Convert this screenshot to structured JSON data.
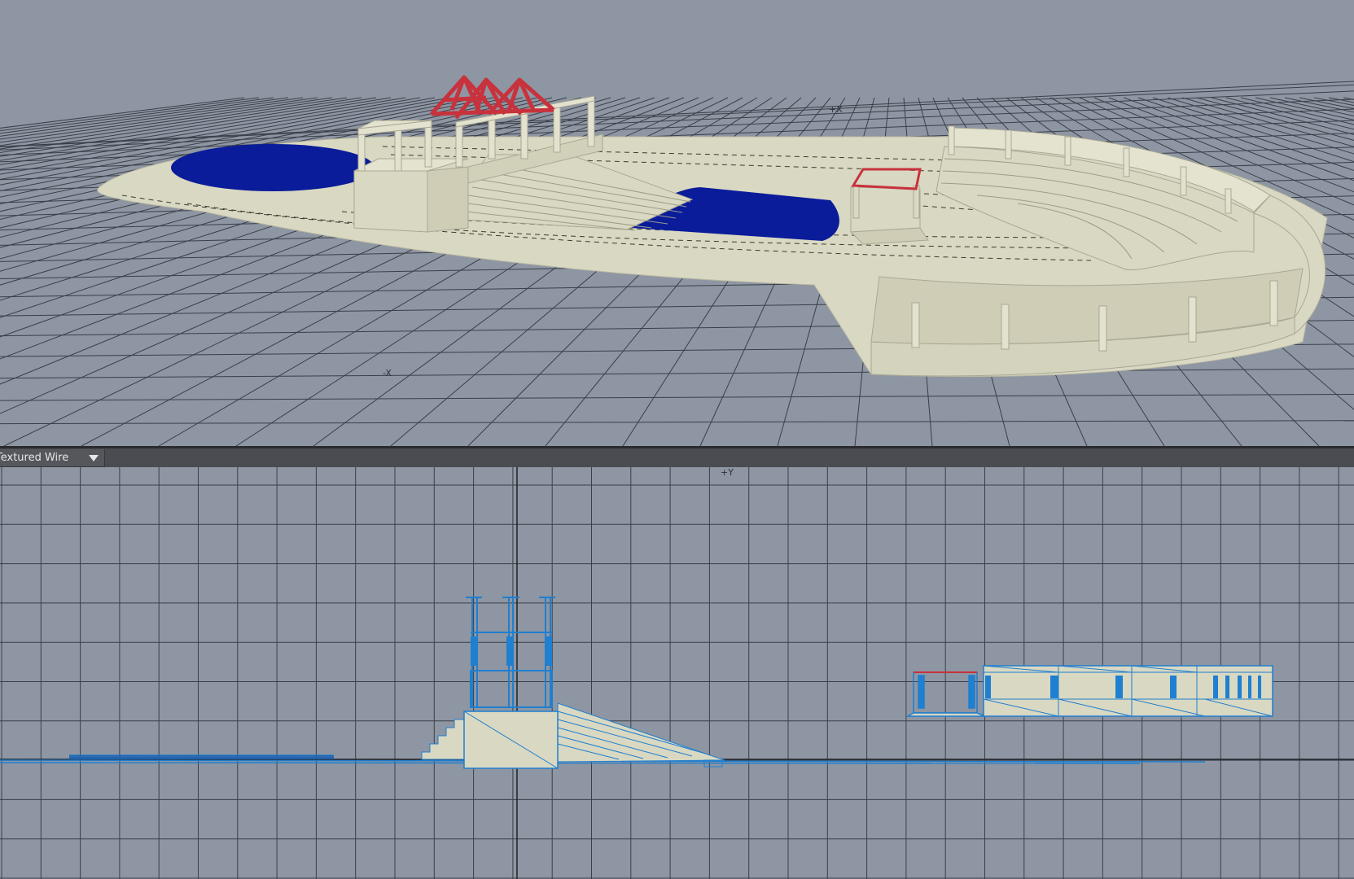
{
  "app": {
    "viewports": {
      "perspective": {
        "axis_labels": {
          "plus_x": "+X",
          "minus_x": "-X"
        }
      },
      "front": {
        "axis_labels": {
          "plus_y": "+Y"
        },
        "shading_mode": "Textured Wire"
      }
    }
  },
  "colors": {
    "background": "#8e96a3",
    "grid_line": "#3a3f48",
    "stone": "#d9d8c2",
    "water": "#0a1c9a",
    "selection_red": "#c8323c",
    "wireframe_blue": "#1f7fd0",
    "toolbar": "#4a4c51"
  },
  "icons": [
    "chevron-down-icon"
  ]
}
